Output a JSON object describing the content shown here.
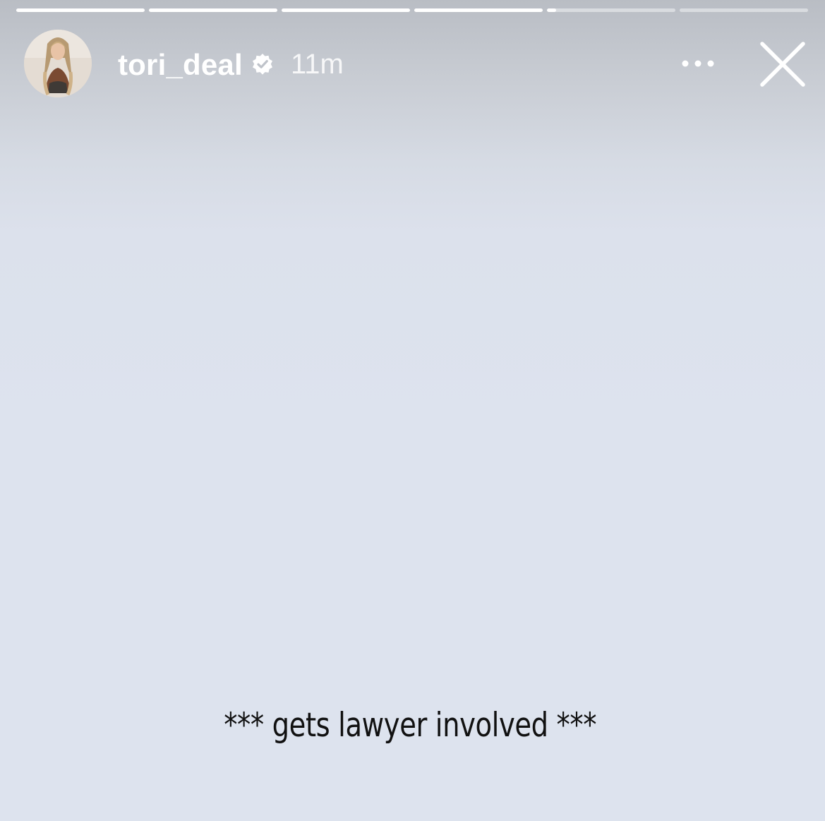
{
  "story": {
    "progress": [
      1,
      1,
      1,
      1,
      0.07,
      0
    ],
    "user": {
      "username": "tori_deal",
      "verified": true,
      "time_ago": "11m",
      "avatar_icon": "profile-photo"
    },
    "caption": "*** gets lawyer involved ***",
    "icons": {
      "more": "more-horizontal-icon",
      "close": "close-icon",
      "verified": "verified-badge-icon"
    },
    "colors": {
      "background": "#dde3ee",
      "header_text": "#ffffff",
      "caption_text": "#111111"
    }
  }
}
